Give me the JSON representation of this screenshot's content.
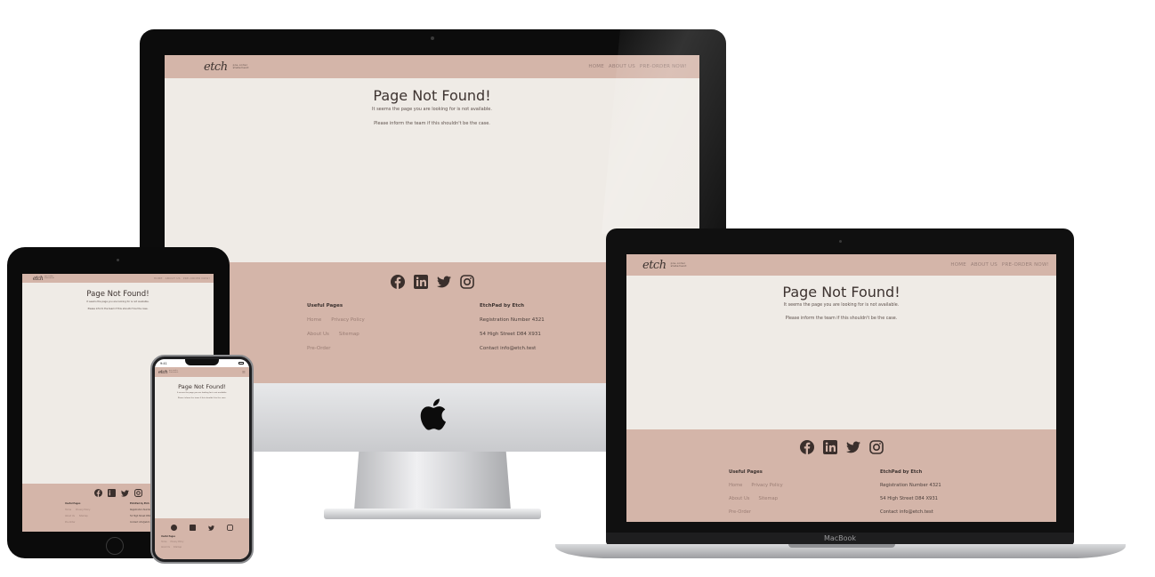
{
  "site": {
    "brand": "etch",
    "tagline_1": "order online",
    "tagline_2": "pre-order",
    "tagline_3": "statement",
    "nav": [
      "HOME",
      "ABOUT US",
      "PRE-ORDER NOW!"
    ],
    "title": "Page Not Found!",
    "line1": "It seems the page you are looking for is not available.",
    "line2": "Please inform the team if this shouldn't be the case.",
    "social_icons": [
      "facebook-icon",
      "linkedin-icon",
      "twitter-icon",
      "instagram-icon"
    ],
    "useful_heading": "Useful Pages",
    "useful_links": [
      "Home",
      "Privacy Policy",
      "About Us",
      "Sitemap",
      "Pre-Order"
    ],
    "company_heading": "EtchPad by Etch",
    "company_lines": [
      "Registration Number 4321",
      "54 High Street D84 X931",
      "Contact info@etch.test"
    ]
  },
  "phone_status": {
    "time": "9:41"
  },
  "laptop_label": "MacBook",
  "colors": {
    "nav": "#d4b5a9",
    "page": "#efebe6",
    "text": "#3d3330",
    "link": "#9a7d74"
  }
}
